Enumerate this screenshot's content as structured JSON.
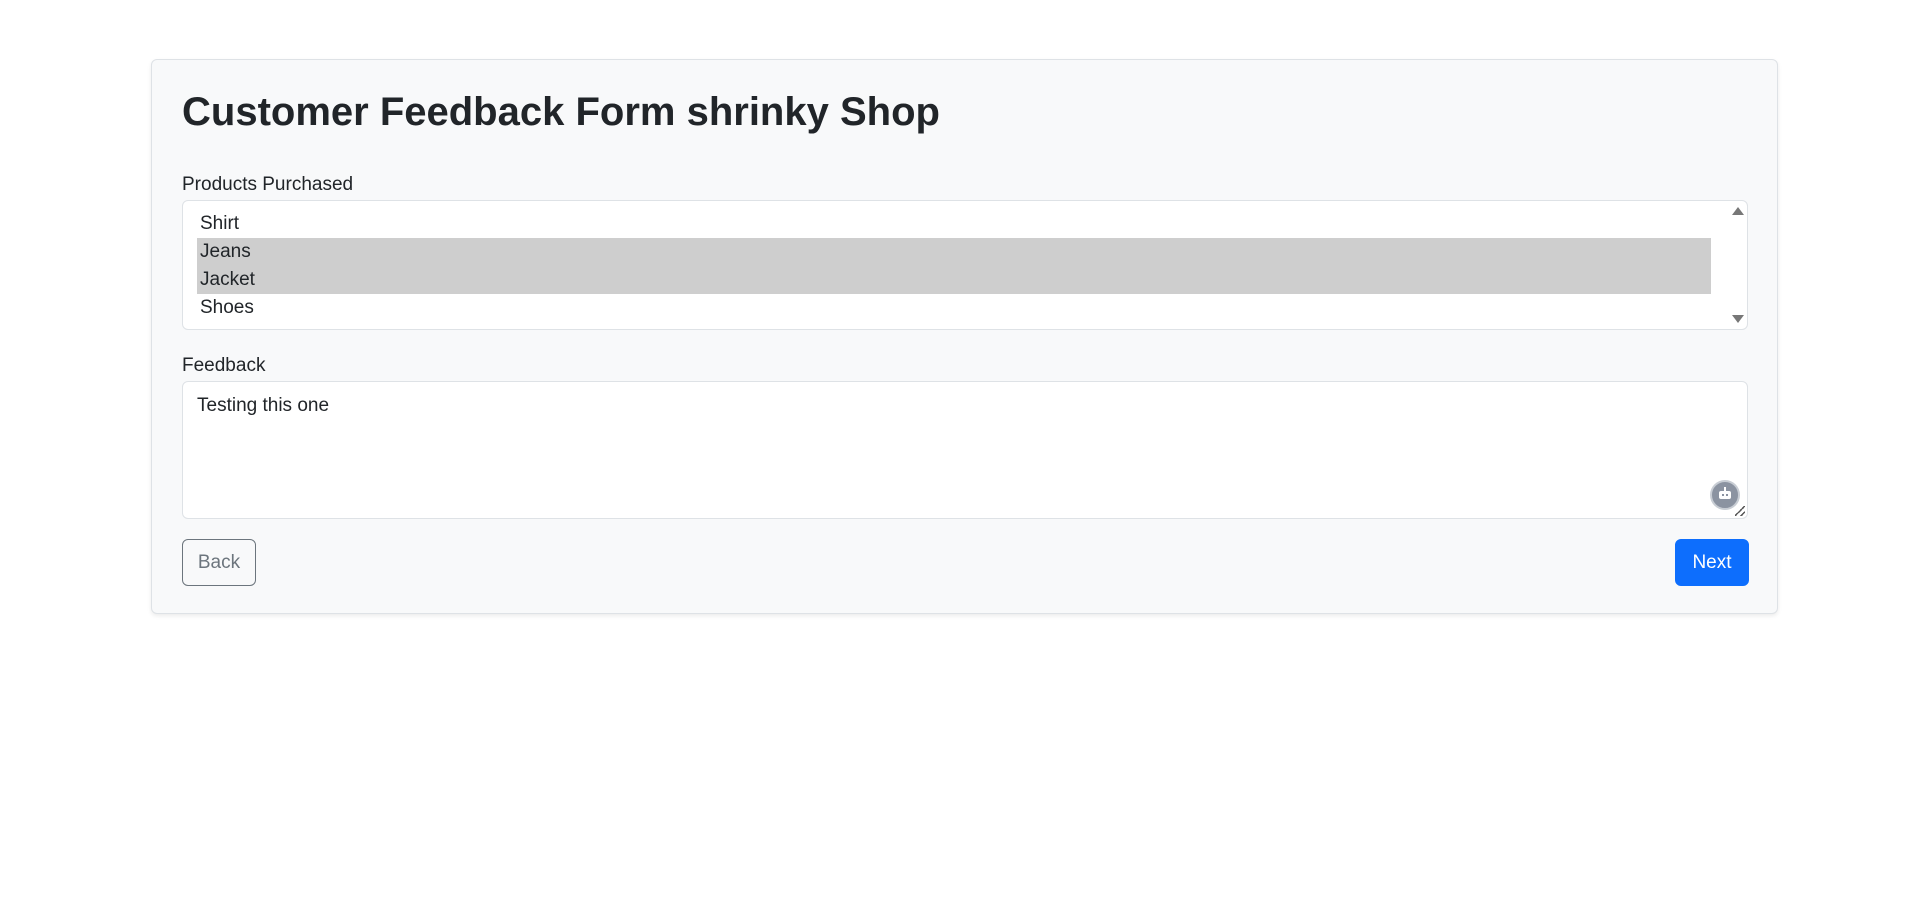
{
  "form": {
    "title": "Customer Feedback Form shrinky Shop",
    "products": {
      "label": "Products Purchased",
      "options": [
        {
          "label": "Shirt",
          "selected": false
        },
        {
          "label": "Jeans",
          "selected": true
        },
        {
          "label": "Jacket",
          "selected": true
        },
        {
          "label": "Shoes",
          "selected": false
        }
      ]
    },
    "feedback": {
      "label": "Feedback",
      "value": "Testing this one"
    },
    "buttons": {
      "back": "Back",
      "next": "Next"
    }
  },
  "colors": {
    "primary": "#0d6efd",
    "secondary": "#6c757d",
    "card_bg": "#f8f9fa",
    "selected_option": "#cecece"
  }
}
